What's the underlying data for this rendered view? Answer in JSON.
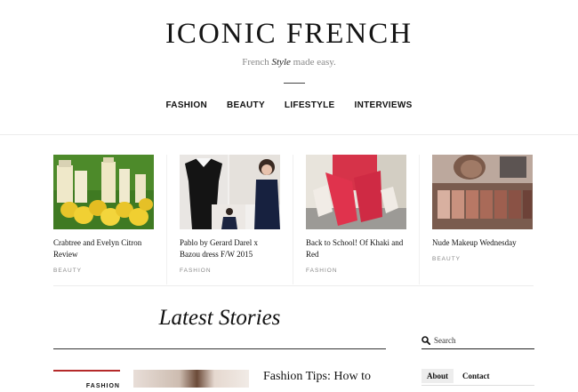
{
  "site": {
    "title": "ICONIC FRENCH",
    "tagline_pre": "French",
    "tagline_em": "Style",
    "tagline_post": "made easy."
  },
  "nav": {
    "items": [
      "FASHION",
      "BEAUTY",
      "LIFESTYLE",
      "INTERVIEWS"
    ]
  },
  "featured": [
    {
      "title": "Crabtree and Evelyn Citron Review",
      "category": "BEAUTY"
    },
    {
      "title": "Pablo by Gerard Darel x Bazou dress F/W 2015",
      "category": "FASHION"
    },
    {
      "title": "Back to School! Of Khaki and Red",
      "category": "FASHION"
    },
    {
      "title": "Nude Makeup Wednesday",
      "category": "BEAUTY"
    }
  ],
  "latest": {
    "heading": "Latest Stories",
    "post": {
      "category": "FASHION",
      "title": "Fashion Tips: How to"
    }
  },
  "sidebar": {
    "search_placeholder": "Search",
    "tabs": [
      "About",
      "Contact"
    ]
  },
  "colors": {
    "accent": "#b52a2a"
  }
}
